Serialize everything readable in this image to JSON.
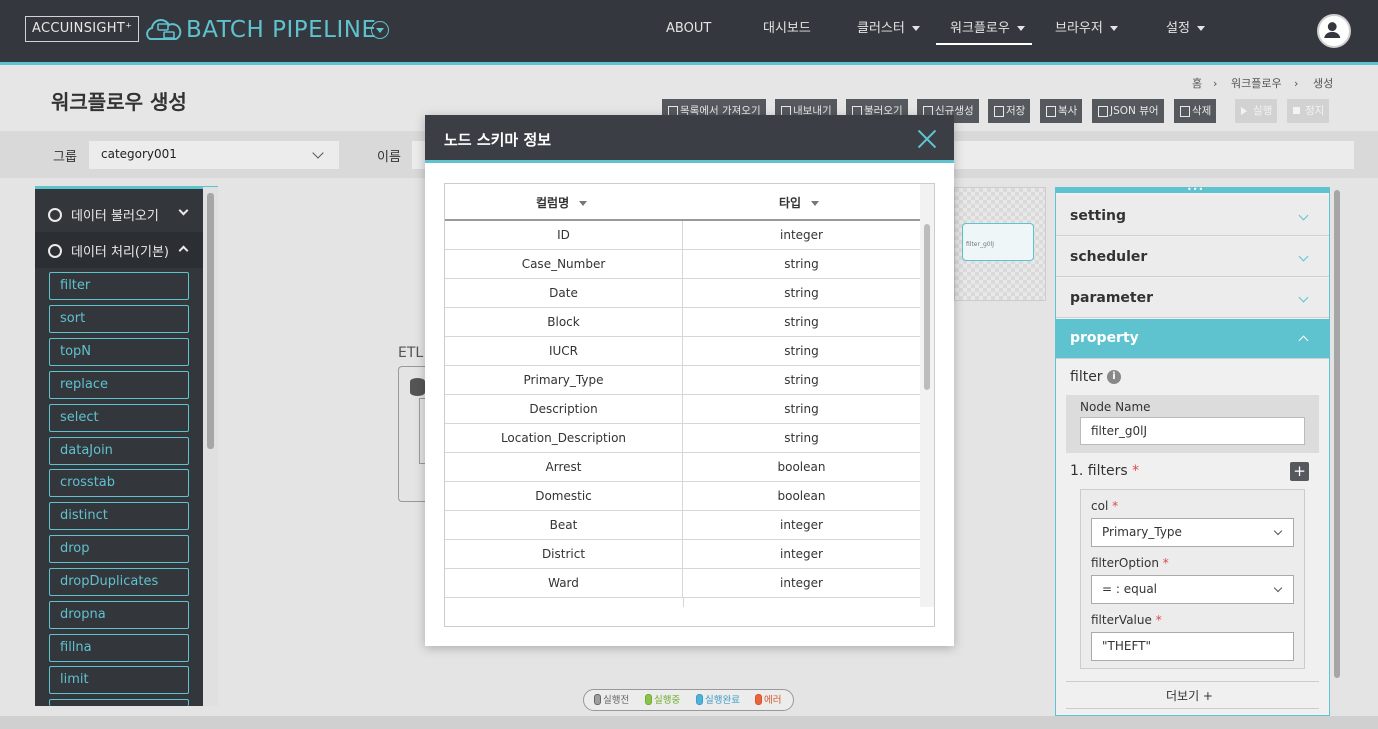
{
  "header": {
    "logo_text": "ACCUINSIGHT⁺",
    "app_title": "BATCH PIPELINE",
    "nav": [
      {
        "label": "ABOUT"
      },
      {
        "label": "대시보드"
      },
      {
        "label": "클러스터"
      },
      {
        "label": "워크플로우"
      },
      {
        "label": "브라우저"
      },
      {
        "label": "설정"
      }
    ],
    "active_nav": "워크플로우"
  },
  "page": {
    "title": "워크플로우 생성",
    "breadcrumb": [
      "홈",
      "워크플로우",
      "생성"
    ]
  },
  "toolbar": {
    "buttons": [
      {
        "label": "목록에서 가져오기"
      },
      {
        "label": "내보내기"
      },
      {
        "label": "불러오기"
      },
      {
        "label": "신규생성"
      },
      {
        "label": "저장"
      },
      {
        "label": "복사"
      },
      {
        "label": "JSON 뷰어"
      },
      {
        "label": "삭제"
      },
      {
        "label": "실행"
      },
      {
        "label": "정지"
      }
    ]
  },
  "filter_row": {
    "group_label": "그룹",
    "group_value": "category001",
    "name_label": "이름"
  },
  "palette": {
    "sections": [
      {
        "label": "데이터 불러오기"
      },
      {
        "label": "데이터 처리(기본)"
      }
    ],
    "items": [
      "filter",
      "sort",
      "topN",
      "replace",
      "select",
      "dataJoin",
      "crosstab",
      "distinct",
      "drop",
      "dropDuplicates",
      "dropna",
      "fillna",
      "limit"
    ]
  },
  "canvas": {
    "etl_label": "ETL",
    "minimap_node_label": "filter_g0lJ",
    "legend": [
      {
        "label": "실행전",
        "color": "#9e9e9e"
      },
      {
        "label": "실행중",
        "color": "#8bc34a"
      },
      {
        "label": "실행완료",
        "color": "#4fb3d9"
      },
      {
        "label": "에러",
        "color": "#e8643c"
      }
    ]
  },
  "right_panel": {
    "accordions": [
      {
        "label": "setting"
      },
      {
        "label": "scheduler"
      },
      {
        "label": "parameter"
      },
      {
        "label": "property"
      }
    ],
    "property": {
      "node_type": "filter",
      "node_name_label": "Node Name",
      "node_name_value": "filter_g0lJ",
      "filters_title": "1. filters",
      "col_label": "col",
      "col_value": "Primary_Type",
      "filter_option_label": "filterOption",
      "filter_option_value": "= : equal",
      "filter_value_label": "filterValue",
      "filter_value": "\"THEFT\"",
      "more_label": "더보기 +"
    }
  },
  "modal": {
    "title": "노드 스키마 정보",
    "columns": [
      "컬럼명",
      "타입"
    ],
    "rows": [
      [
        "ID",
        "integer"
      ],
      [
        "Case_Number",
        "string"
      ],
      [
        "Date",
        "string"
      ],
      [
        "Block",
        "string"
      ],
      [
        "IUCR",
        "string"
      ],
      [
        "Primary_Type",
        "string"
      ],
      [
        "Description",
        "string"
      ],
      [
        "Location_Description",
        "string"
      ],
      [
        "Arrest",
        "boolean"
      ],
      [
        "Domestic",
        "boolean"
      ],
      [
        "Beat",
        "integer"
      ],
      [
        "District",
        "integer"
      ],
      [
        "Ward",
        "integer"
      ]
    ]
  }
}
